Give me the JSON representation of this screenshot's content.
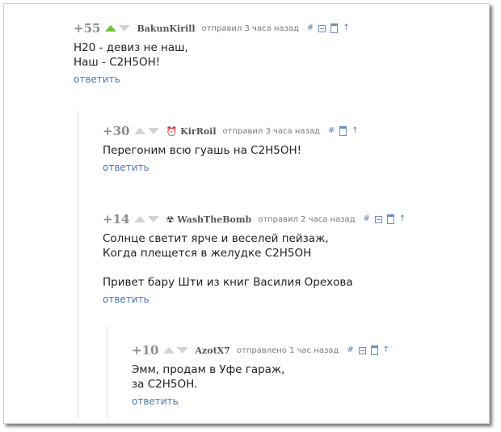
{
  "comments": [
    {
      "rating": "+55",
      "author": "BakunKirill",
      "avatar_icon": "",
      "meta": "отправил 3 часа назад",
      "upvoted": true,
      "lines": [
        "H20 - девиз не наш,",
        "Наш - C2H5OH!"
      ],
      "reply": "ответить"
    },
    {
      "rating": "+30",
      "author": "KirRoil",
      "avatar_icon": "alarm-clock-icon",
      "avatar_glyph": "⏰",
      "meta": "отправил 3 часа назад",
      "upvoted": false,
      "lines": [
        "Перегоним всю гуашь на C2H5OH!"
      ],
      "reply": "ответить"
    },
    {
      "rating": "+14",
      "author": "WashTheBomb",
      "avatar_icon": "radiation-icon",
      "avatar_glyph": "☢",
      "meta": "отправил 2 часа назад",
      "upvoted": false,
      "lines": [
        "Солнце светит ярче и веселей пейзаж,",
        "Когда плещется в желудке C2H5OH",
        "",
        "Привет бару Шти из книг Василия Орехова"
      ],
      "reply": "ответить"
    },
    {
      "rating": "+10",
      "author": "AzotX7",
      "avatar_icon": "",
      "meta": "отправлено 1 час назад",
      "upvoted": false,
      "lines": [
        "Эмм, продам в Уфе гараж,",
        "за C2H5OH."
      ],
      "reply": "ответить"
    }
  ],
  "tools": {
    "link_glyph": "#",
    "up_glyph": "↑"
  },
  "colors": {
    "upvote_active": "#6fc43a",
    "link": "#4a76b6",
    "thread_line": "#dcdcdc"
  }
}
